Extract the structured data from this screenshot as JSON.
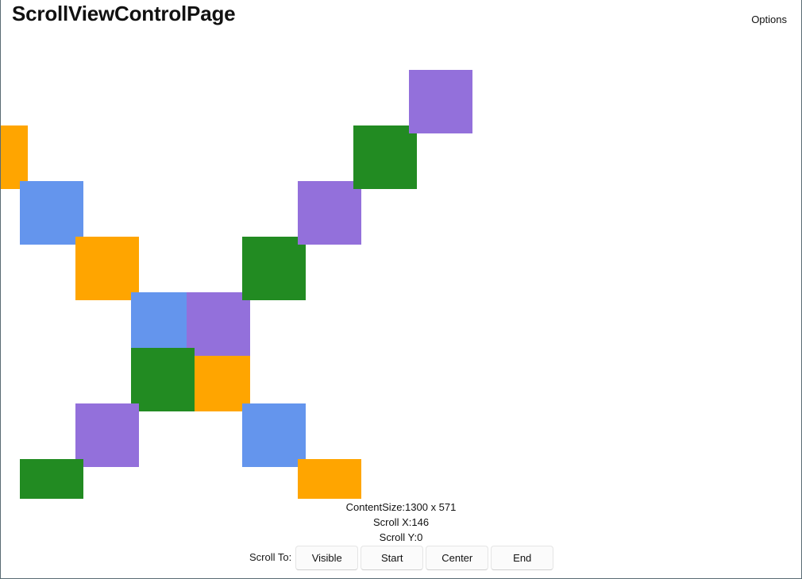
{
  "header": {
    "title": "ScrollViewControlPage",
    "options_label": "Options"
  },
  "scroll_view": {
    "tiles": [
      {
        "name": "tile-1",
        "color": "#FFA500"
      },
      {
        "name": "tile-2",
        "color": "#6495ED"
      },
      {
        "name": "tile-3",
        "color": "#FFA500"
      },
      {
        "name": "tile-4",
        "color": "#6495ED"
      },
      {
        "name": "tile-5",
        "color": "#9370DB"
      },
      {
        "name": "tile-6",
        "color": "#228B22"
      },
      {
        "name": "tile-7",
        "color": "#FFA500"
      },
      {
        "name": "tile-8",
        "color": "#9370DB"
      },
      {
        "name": "tile-9",
        "color": "#228B22"
      },
      {
        "name": "tile-10",
        "color": "#228B22"
      },
      {
        "name": "tile-11",
        "color": "#9370DB"
      },
      {
        "name": "tile-12",
        "color": "#228B22"
      },
      {
        "name": "tile-13",
        "color": "#9370DB"
      },
      {
        "name": "tile-14",
        "color": "#6495ED"
      },
      {
        "name": "tile-15",
        "color": "#FFA500"
      }
    ]
  },
  "status": {
    "content_size": "ContentSize:1300 x 571",
    "scroll_x": "Scroll X:146",
    "scroll_y": "Scroll Y:0"
  },
  "scroll_to": {
    "label": "Scroll To:",
    "visible_label": "Visible",
    "start_label": "Start",
    "center_label": "Center",
    "end_label": "End"
  }
}
